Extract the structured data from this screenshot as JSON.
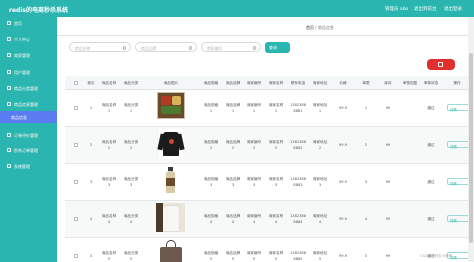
{
  "app": {
    "title": "redis的电商秒杀系统"
  },
  "topnav": {
    "user": "管理员 abo",
    "exit_front": "退出到前台",
    "logout": "退出登录"
  },
  "sidebar": {
    "items": [
      {
        "label": "首页"
      },
      {
        "label": "个人中心"
      },
      {
        "label": "商家管理"
      },
      {
        "label": "用户管理"
      },
      {
        "label": "商品分类管理"
      },
      {
        "label": "商品信息管理"
      },
      {
        "label": "商品信息"
      },
      {
        "label": "订单评价管理"
      },
      {
        "label": "秒杀订单管理"
      },
      {
        "label": "系统管理"
      }
    ]
  },
  "breadcrumb": {
    "home": "首页",
    "sep": "/",
    "current": "商品信息"
  },
  "filters": [
    {
      "placeholder": "商品名称"
    },
    {
      "placeholder": "商品品牌"
    },
    {
      "placeholder": "商家编号"
    }
  ],
  "buttons": {
    "search": "查询",
    "delete_icon": "trash-icon"
  },
  "table": {
    "headers": [
      "索引",
      "商品名称",
      "商品分类",
      "商品图片",
      "商品规格",
      "商品品牌",
      "商家编号",
      "商家名称",
      "联系电话",
      "商家地址",
      "价格",
      "单限",
      "库存",
      "审核回复",
      "审核状态",
      "操作"
    ],
    "rows": [
      {
        "index": "1",
        "name": "商品名称1",
        "category": "商品分类1",
        "spec": "商品规格1",
        "brand": "商品品牌1",
        "shop_no": "商家编号1",
        "shop_name": "商家名称1",
        "phone": "13823888881",
        "address": "商家地址1",
        "price": "99.9",
        "limit": "1",
        "stock": "99",
        "reply": "",
        "status": "通过",
        "action": "详情",
        "image": "food-box-image"
      },
      {
        "index": "2",
        "name": "商品名称2",
        "category": "商品分类2",
        "spec": "商品规格2",
        "brand": "商品品牌2",
        "shop_no": "商家编号2",
        "shop_name": "商家名称2",
        "phone": "13823888882",
        "address": "商家地址2",
        "price": "99.9",
        "limit": "2",
        "stock": "99",
        "reply": "",
        "status": "通过",
        "action": "详情",
        "image": "black-sweater-image"
      },
      {
        "index": "3",
        "name": "商品名称3",
        "category": "商品分类3",
        "spec": "商品规格3",
        "brand": "商品品牌3",
        "shop_no": "商家编号3",
        "shop_name": "商家名称3",
        "phone": "13823888883",
        "address": "商家地址3",
        "price": "99.9",
        "limit": "3",
        "stock": "99",
        "reply": "",
        "status": "通过",
        "action": "详情",
        "image": "drink-bottle-image"
      },
      {
        "index": "4",
        "name": "商品名称4",
        "category": "商品分类4",
        "spec": "商品规格4",
        "brand": "商品品牌4",
        "shop_no": "商家编号4",
        "shop_name": "商家名称4",
        "phone": "13823888884",
        "address": "商家地址4",
        "price": "99.9",
        "limit": "4",
        "stock": "99",
        "reply": "",
        "status": "通过",
        "action": "详情",
        "image": "white-blouse-image"
      },
      {
        "index": "5",
        "name": "商品名称5",
        "category": "商品分类5",
        "spec": "商品规格5",
        "brand": "商品品牌5",
        "shop_no": "商家编号5",
        "shop_name": "商家名称5",
        "phone": "13823888885",
        "address": "商家地址5",
        "price": "99.9",
        "limit": "5",
        "stock": "99",
        "reply": "",
        "status": "通过",
        "action": "详情",
        "image": "handbag-image"
      }
    ]
  },
  "watermark": "CSDN @码农小锋锋",
  "colors": {
    "primary": "#2bb5b0",
    "active": "#5b7cf0",
    "danger": "#e0302e"
  }
}
